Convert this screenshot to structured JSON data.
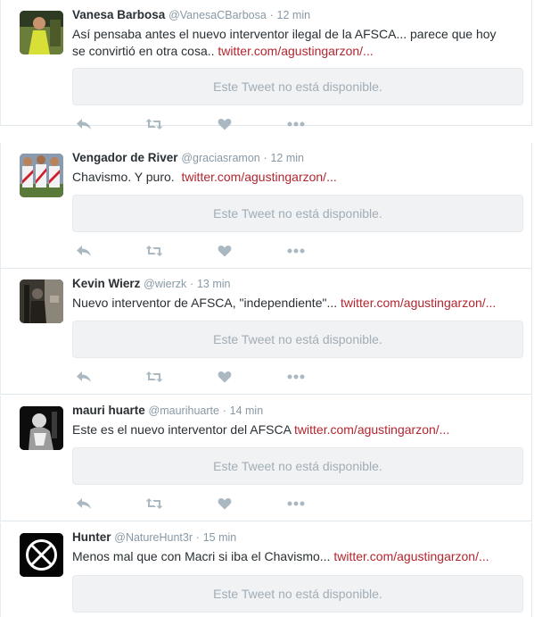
{
  "tweets": [
    {
      "name": "Vanesa Barbosa",
      "handle": "@VanesaCBarbosa",
      "separator": "·",
      "time": "12 min",
      "text_line1": "Así pensaba antes el nuevo interventor ilegal de la AFSCA... parece que hoy",
      "text_line2": "se convirtió en otra cosa.. ",
      "link": "twitter.com/agustingarzon/...",
      "unavailable": "Este Tweet no está disponible.",
      "avatar": "woman-yellow-dress-photo"
    },
    {
      "name": "Vengador de River",
      "handle": "@graciasramon",
      "separator": "·",
      "time": "12 min",
      "text_line1": "Chavismo. Y puro.  ",
      "link": "twitter.com/agustingarzon/...",
      "unavailable": "Este Tweet no está disponible.",
      "avatar": "river-players-photo"
    },
    {
      "name": "Kevin Wierz",
      "handle": "@wierzk",
      "separator": "·",
      "time": "13 min",
      "text_line1": "Nuevo interventor de AFSCA, \"independiente\"... ",
      "link": "twitter.com/agustingarzon/...",
      "unavailable": "Este Tweet no está disponible.",
      "avatar": "dark-room-photo"
    },
    {
      "name": "mauri huarte",
      "handle": "@maurihuarte",
      "separator": "·",
      "time": "14 min",
      "text_line1": "Este es el nuevo interventor del AFSCA ",
      "link": "twitter.com/agustingarzon/...",
      "unavailable": "Este Tweet no está disponible.",
      "avatar": "bw-portrait-photo"
    },
    {
      "name": "Hunter",
      "handle": "@NatureHunt3r",
      "separator": "·",
      "time": "15 min",
      "text_line1": "Menos mal que con Macri si iba el Chavismo... ",
      "link": "twitter.com/agustingarzon/...",
      "unavailable": "Este Tweet no está disponible.",
      "avatar": "x-circle-logo"
    }
  ],
  "action_icons": [
    "reply-icon",
    "retweet-icon",
    "like-heart-icon",
    "more-dots-icon"
  ],
  "colors": {
    "link": "#b3252f",
    "meta": "#8899a6",
    "icon": "#aab8c2"
  }
}
